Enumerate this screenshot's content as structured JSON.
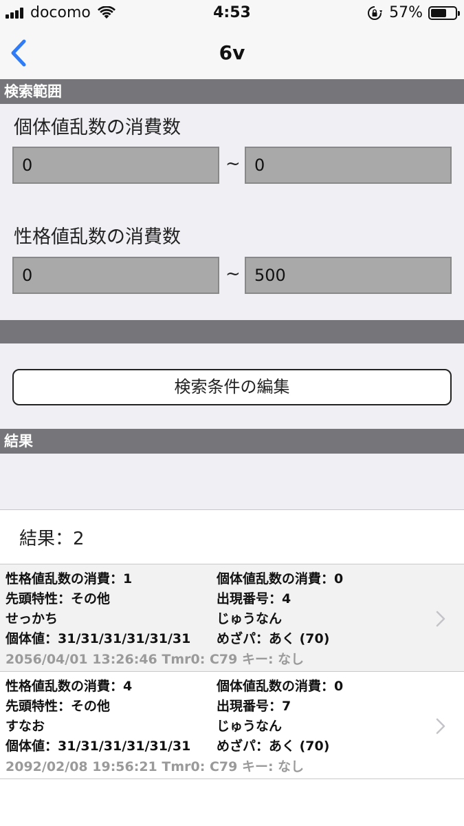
{
  "status_bar": {
    "carrier": "docomo",
    "time": "4:53",
    "battery_percent": "57%"
  },
  "nav": {
    "title": "6v",
    "back_icon": "chevron-left-icon"
  },
  "search_range": {
    "header": "検索範囲",
    "ivs_label": "個体値乱数の消費数",
    "ivs_from": "0",
    "ivs_to": "0",
    "nature_label": "性格値乱数の消費数",
    "nature_from": "0",
    "nature_to": "500",
    "tilde": "~"
  },
  "edit_button_label": "検索条件の編集",
  "results": {
    "header": "結果",
    "count_label": "結果：2",
    "items": [
      {
        "nature_consumption": "性格値乱数の消費：1",
        "iv_consumption": "個体値乱数の消費：0",
        "lead_ability": "先頭特性：その他",
        "appearance_no": "出現番号：4",
        "nature": "せっかち",
        "characteristic": "じゅうなん",
        "ivs": "個体値：31/31/31/31/31/31",
        "hidden_power": "めざパ：あく (70)",
        "meta": "2056/04/01  13:26:46  Tmr0: C79  キー: なし"
      },
      {
        "nature_consumption": "性格値乱数の消費：4",
        "iv_consumption": "個体値乱数の消費：0",
        "lead_ability": "先頭特性：その他",
        "appearance_no": "出現番号：7",
        "nature": "すなお",
        "characteristic": "じゅうなん",
        "ivs": "個体値：31/31/31/31/31/31",
        "hidden_power": "めざパ：あく (70)",
        "meta": "2092/02/08  19:56:21  Tmr0: C79  キー: なし"
      }
    ]
  },
  "colors": {
    "accent": "#2f7cf6",
    "section_header": "#76767a",
    "input_bg": "#a9a9a9"
  }
}
